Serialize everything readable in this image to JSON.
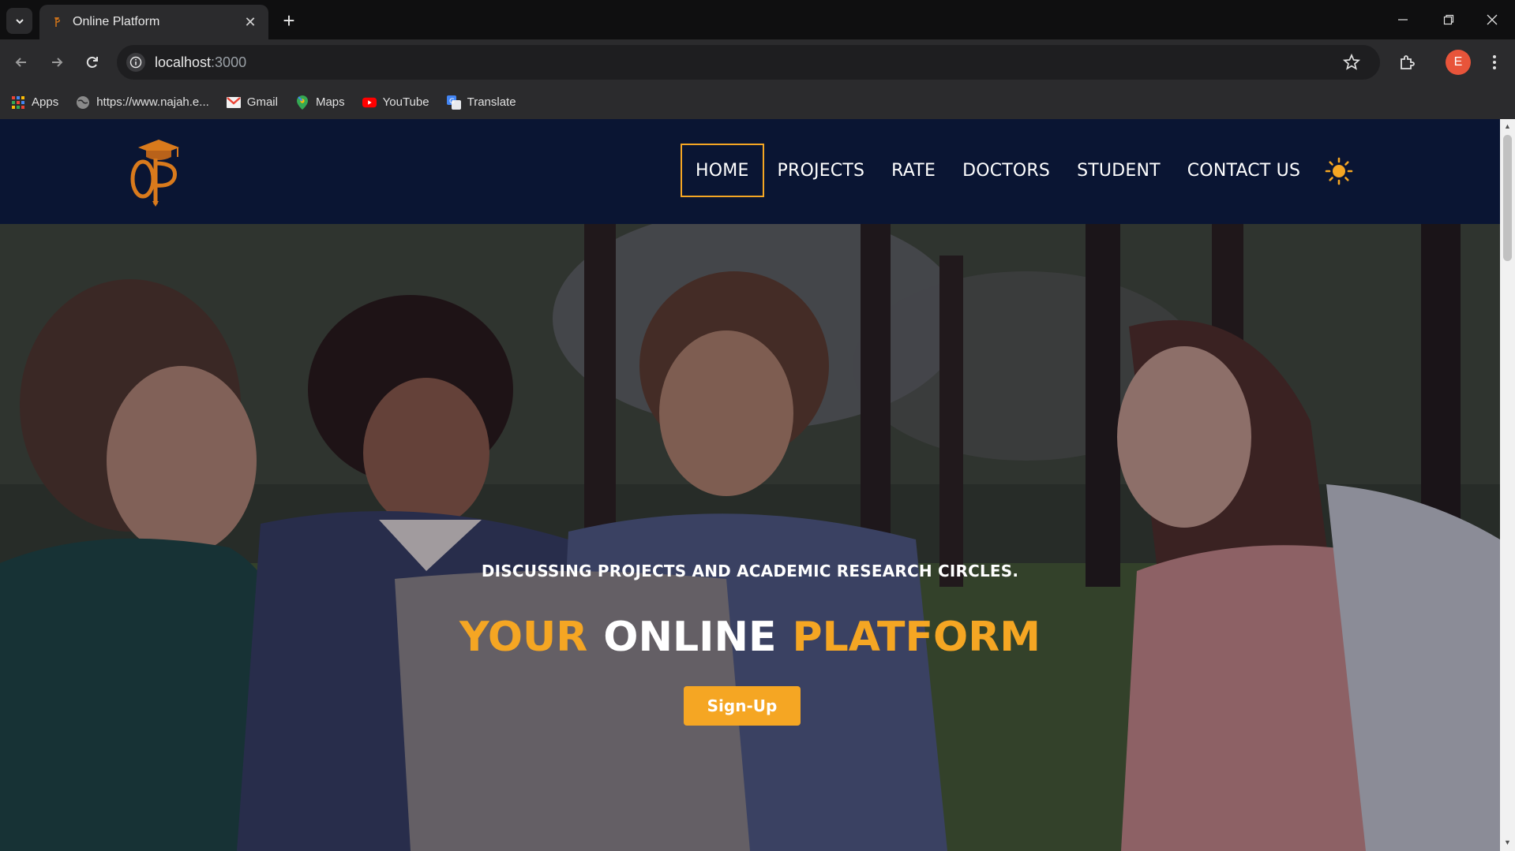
{
  "browser": {
    "tab_title": "Online Platform",
    "url_host": "localhost",
    "url_port": ":3000",
    "profile_initial": "E",
    "bookmarks": [
      {
        "label": "Apps",
        "icon": "apps-grid-icon"
      },
      {
        "label": "https://www.najah.e...",
        "icon": "globe-icon"
      },
      {
        "label": "Gmail",
        "icon": "gmail-icon"
      },
      {
        "label": "Maps",
        "icon": "maps-pin-icon"
      },
      {
        "label": "YouTube",
        "icon": "youtube-icon"
      },
      {
        "label": "Translate",
        "icon": "translate-icon"
      }
    ]
  },
  "site": {
    "nav": [
      {
        "label": "HOME",
        "active": true
      },
      {
        "label": "PROJECTS",
        "active": false
      },
      {
        "label": "RATE",
        "active": false
      },
      {
        "label": "DOCTORS",
        "active": false
      },
      {
        "label": "STUDENT",
        "active": false
      },
      {
        "label": "CONTACT US",
        "active": false
      }
    ],
    "theme_toggle_icon": "sun-icon",
    "logo_icon": "graduation-cap-logo-icon"
  },
  "hero": {
    "subtitle": "DISCUSSING PROJECTS AND ACADEMIC RESEARCH CIRCLES.",
    "title_word1": "YOUR",
    "title_word2": "ONLINE",
    "title_word3": "PLATFORM",
    "signup_label": "Sign-Up"
  },
  "colors": {
    "accent": "#f5a623",
    "navbar_bg": "#0a1533",
    "text": "#ffffff"
  }
}
